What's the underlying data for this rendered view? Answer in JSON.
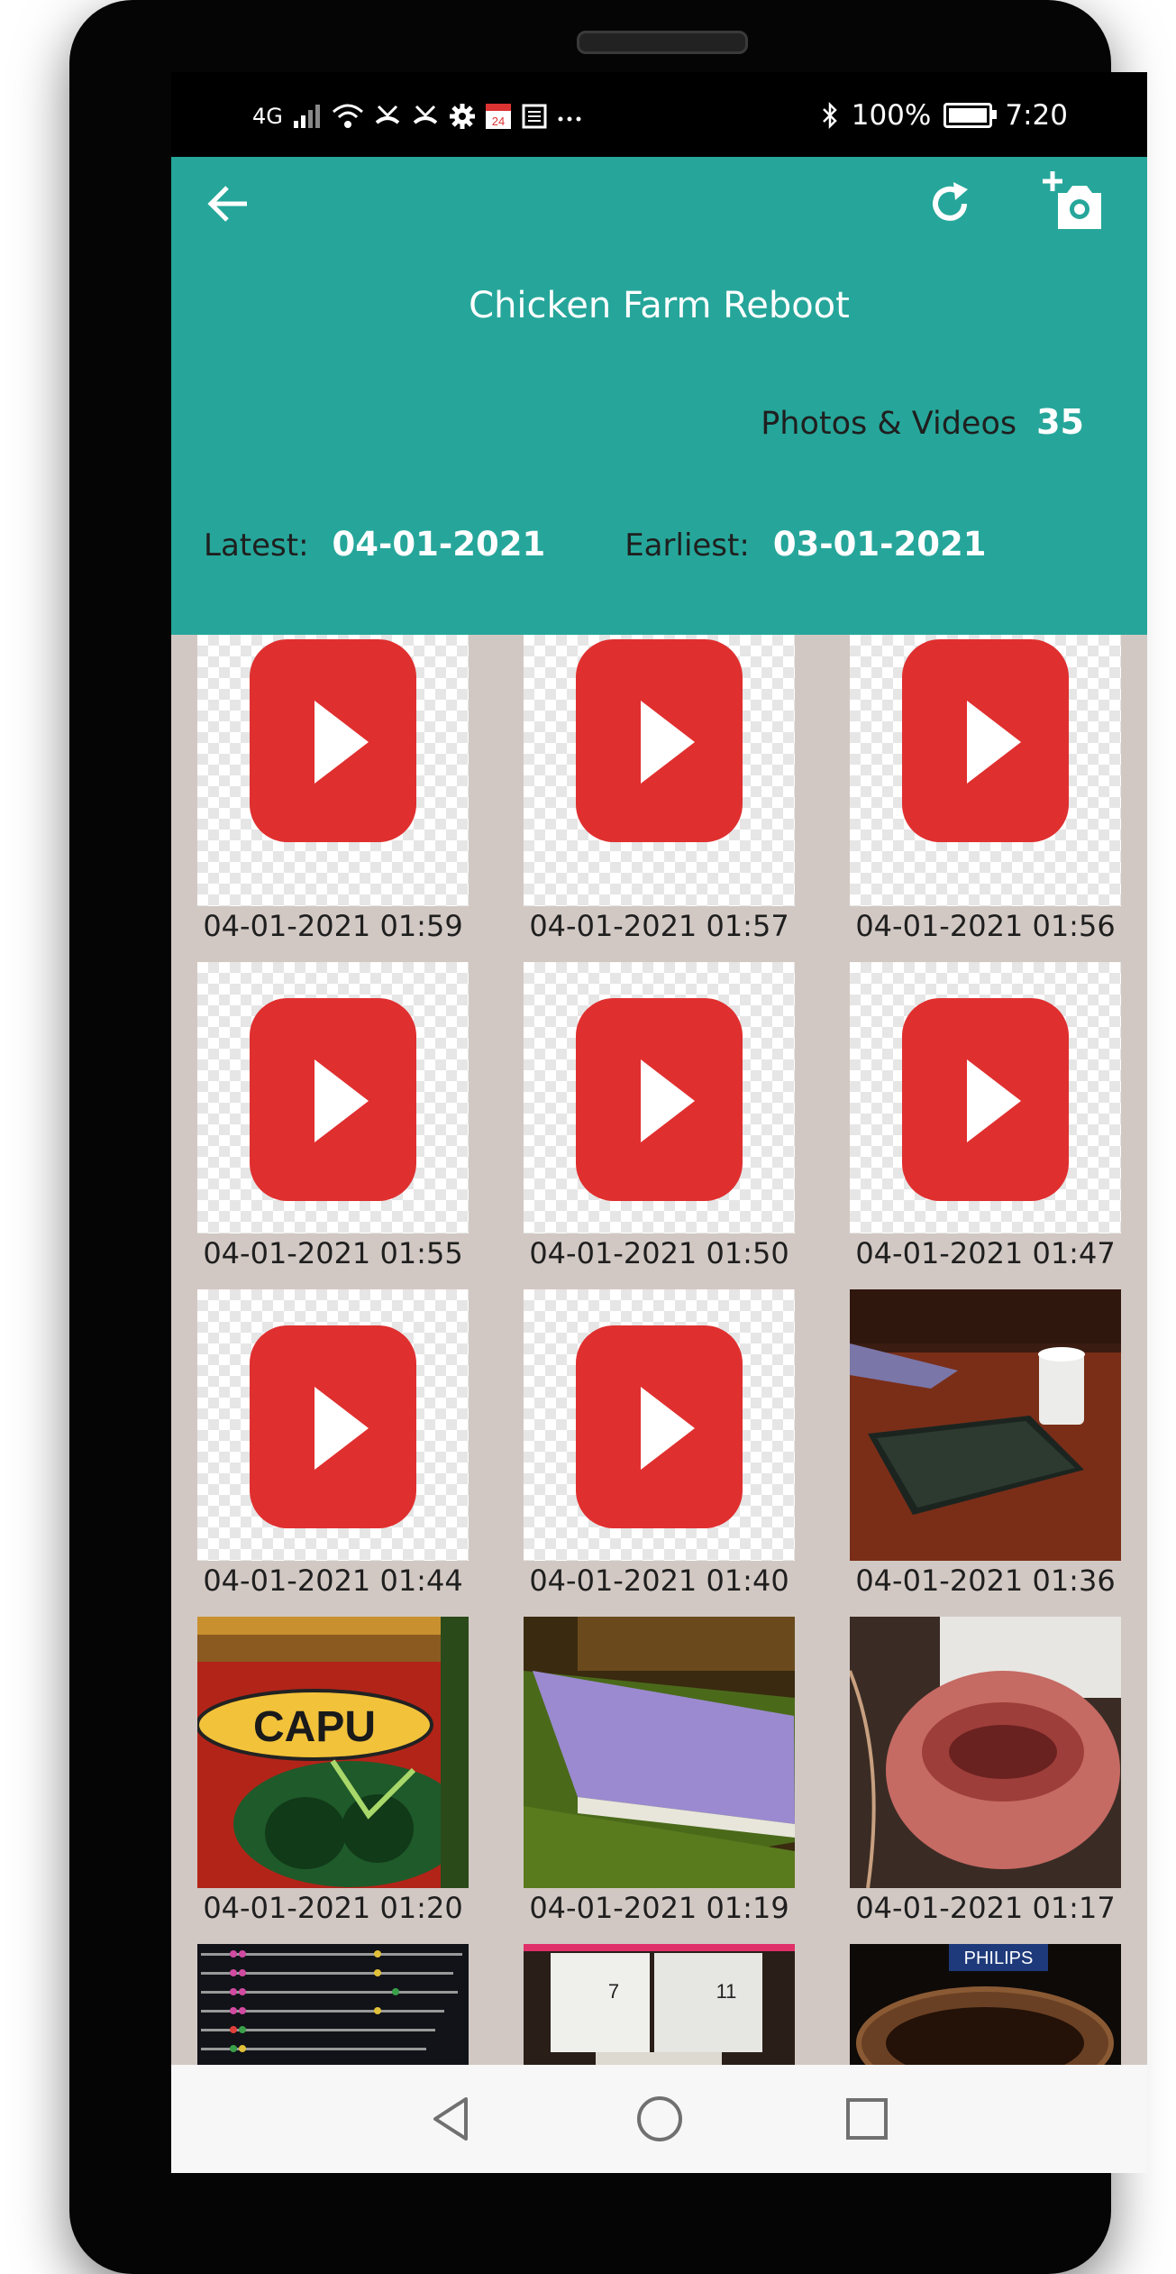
{
  "status": {
    "network": "4G",
    "battery": "100%",
    "time": "7:20"
  },
  "header": {
    "title": "Chicken Farm Reboot",
    "count_label": "Photos & Videos",
    "count_value": "35",
    "latest_label": "Latest:",
    "latest_value": "04-01-2021",
    "earliest_label": "Earliest:",
    "earliest_value": "03-01-2021"
  },
  "colors": {
    "accent": "#26a69a",
    "grid_bg": "#d2c8c3",
    "play_red": "#e02f2f"
  },
  "icons": {
    "back": "arrow-left-icon",
    "refresh": "refresh-icon",
    "add_photo": "add-photo-camera-icon"
  },
  "media": [
    {
      "type": "video",
      "caption": "04-01-2021 01:59"
    },
    {
      "type": "video",
      "caption": "04-01-2021 01:57"
    },
    {
      "type": "video",
      "caption": "04-01-2021 01:56"
    },
    {
      "type": "video",
      "caption": "04-01-2021 01:55"
    },
    {
      "type": "video",
      "caption": "04-01-2021 01:50"
    },
    {
      "type": "video",
      "caption": "04-01-2021 01:47"
    },
    {
      "type": "video",
      "caption": "04-01-2021 01:44"
    },
    {
      "type": "video",
      "caption": "04-01-2021 01:40"
    },
    {
      "type": "photo",
      "caption": "04-01-2021 01:36"
    },
    {
      "type": "photo",
      "caption": "04-01-2021 01:20",
      "logo_text": "CAPU"
    },
    {
      "type": "photo",
      "caption": "04-01-2021 01:19"
    },
    {
      "type": "photo",
      "caption": "04-01-2021 01:17"
    },
    {
      "type": "photo",
      "caption": ""
    },
    {
      "type": "photo",
      "caption": "",
      "label_a": "7",
      "label_b": "11"
    },
    {
      "type": "photo",
      "caption": "",
      "logo_text": "PHILIPS"
    }
  ]
}
